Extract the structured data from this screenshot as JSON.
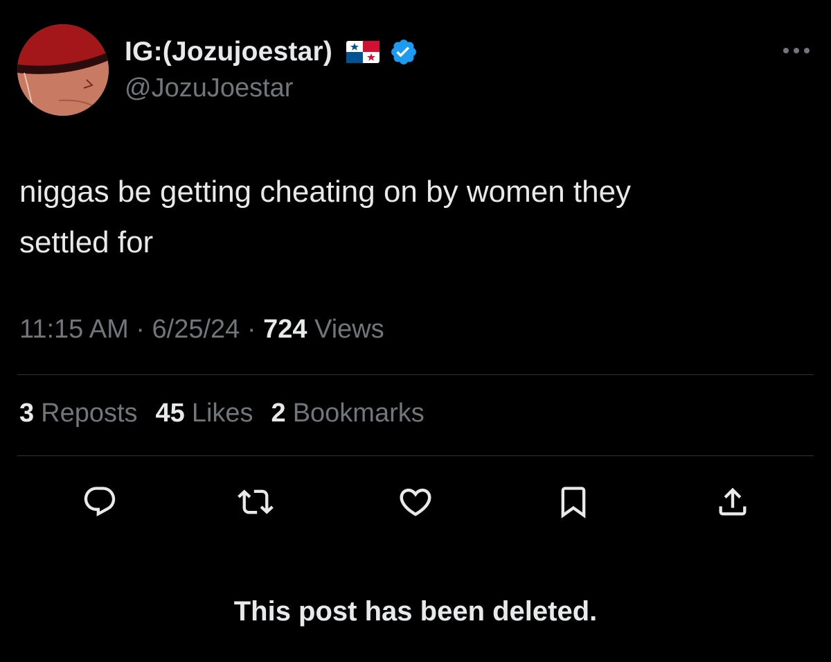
{
  "author": {
    "display_name": "IG:(Jozujoestar)",
    "handle": "@JozuJoestar",
    "flag_icon": "panama-flag-icon",
    "verified_icon": "verified-badge-icon",
    "verified_color": "#1d9bf0"
  },
  "post": {
    "text_line1": "niggas be getting cheating on by women they",
    "text_line2": "settled for"
  },
  "meta": {
    "time": "11:15 AM",
    "separator": "·",
    "date": "6/25/24",
    "views_count": "724",
    "views_label": "Views"
  },
  "stats": {
    "reposts_count": "3",
    "reposts_label": "Reposts",
    "likes_count": "45",
    "likes_label": "Likes",
    "bookmarks_count": "2",
    "bookmarks_label": "Bookmarks"
  },
  "actions": [
    "reply-icon",
    "repost-icon",
    "like-icon",
    "bookmark-icon",
    "share-icon"
  ],
  "notice": "This post has been deleted.",
  "colors": {
    "background": "#000000",
    "primary_text": "#e7e9ea",
    "secondary_text": "#71767b",
    "divider": "#2f3336"
  }
}
